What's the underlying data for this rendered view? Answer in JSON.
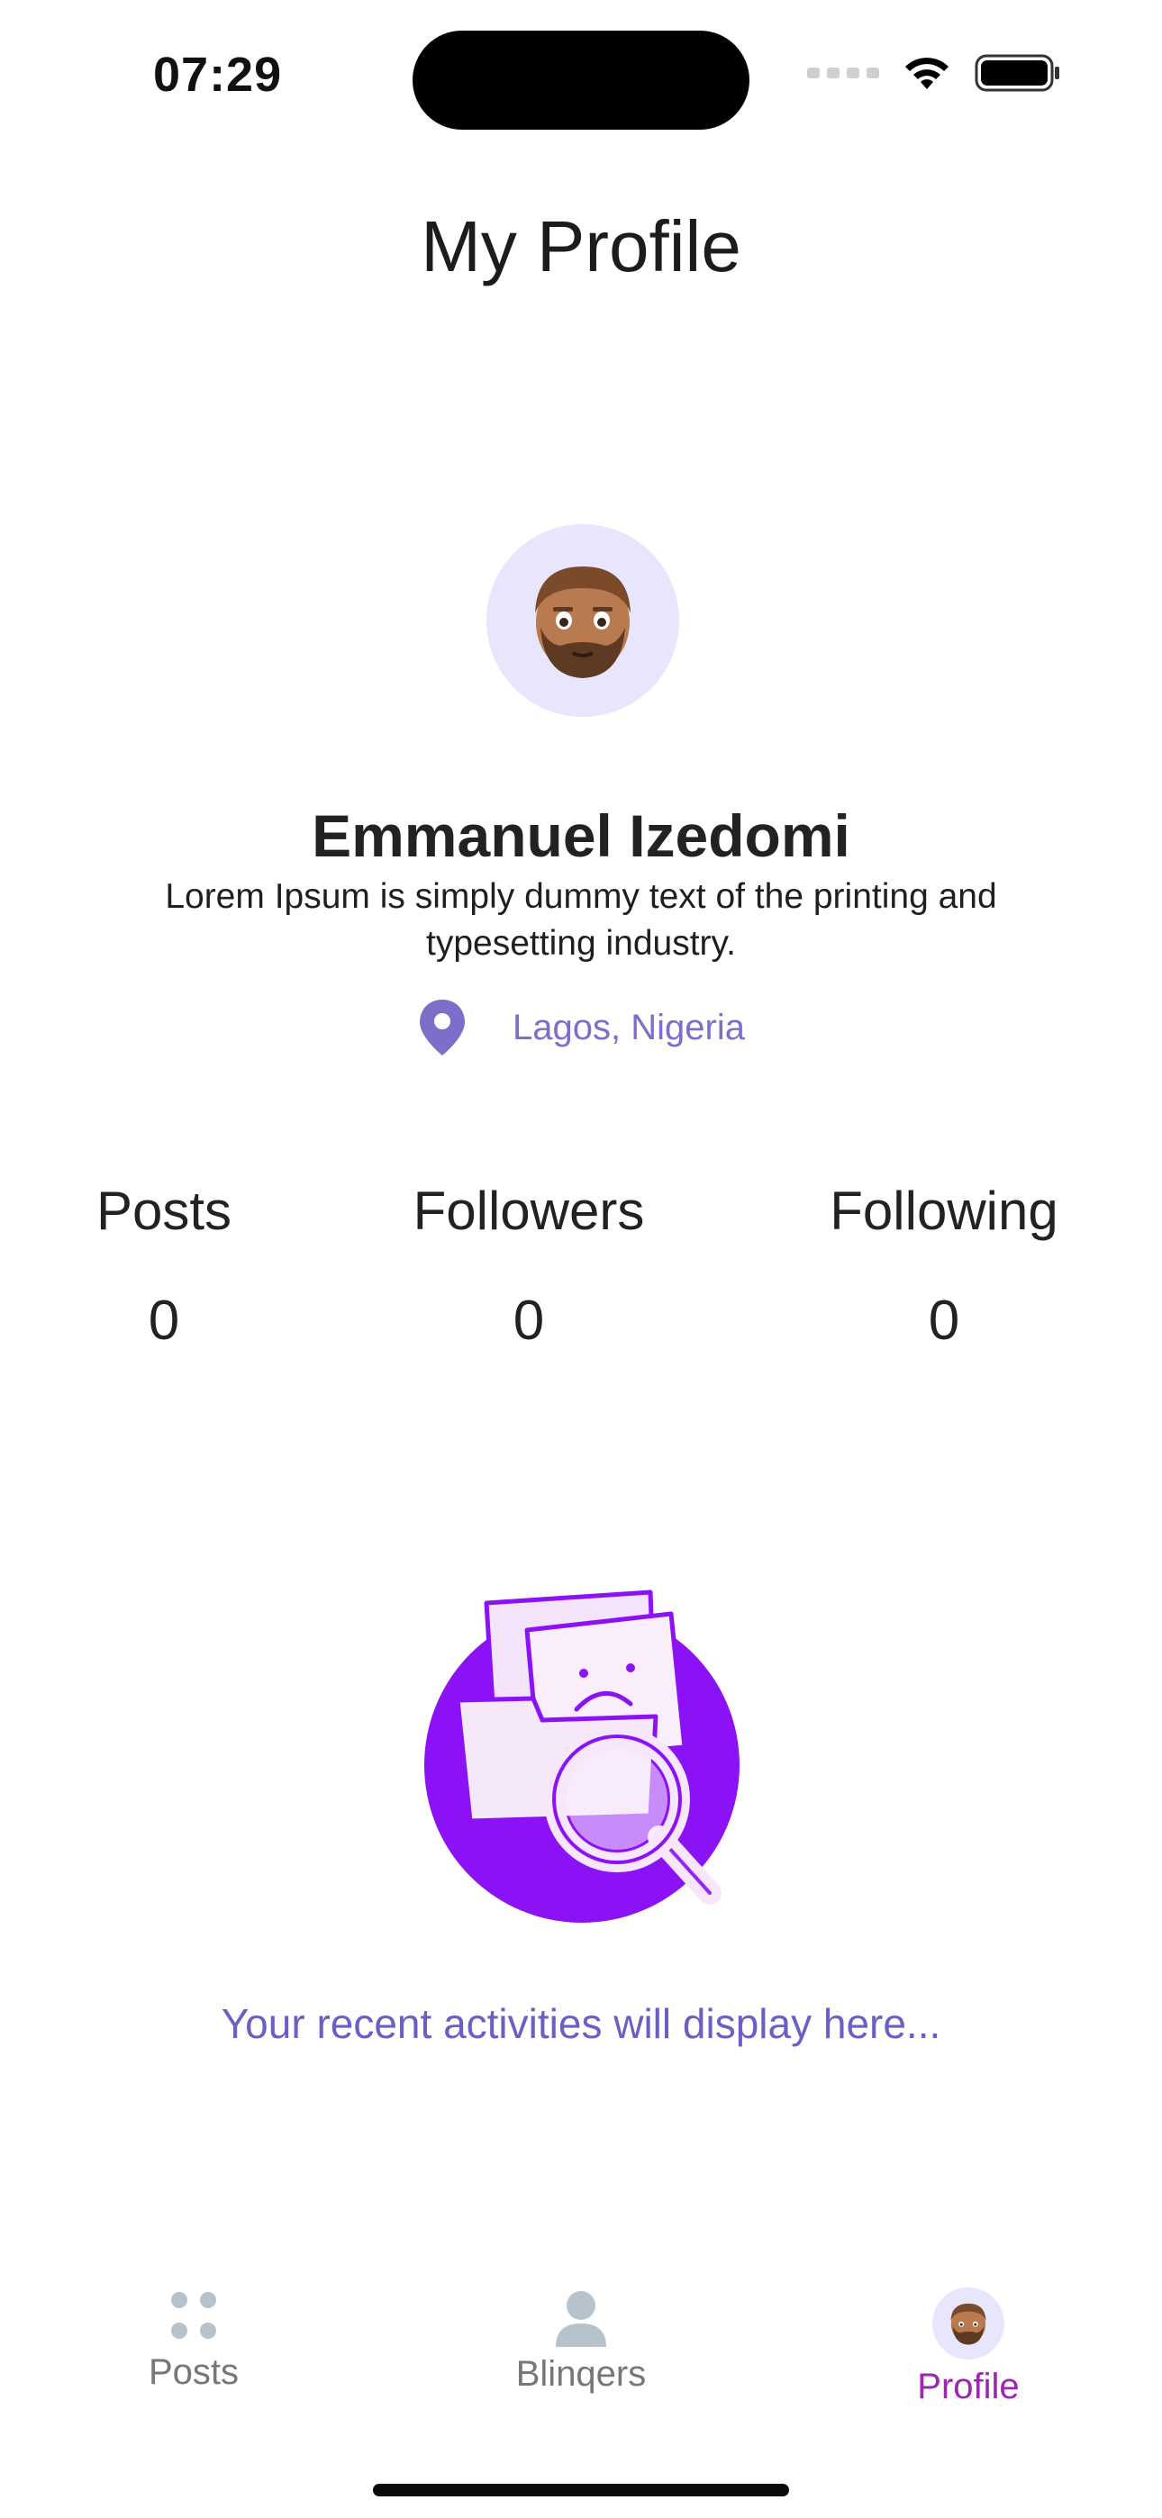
{
  "status_bar": {
    "time": "07:29"
  },
  "header": {
    "title": "My Profile"
  },
  "profile": {
    "name": "Emmanuel Izedomi",
    "bio": "Lorem Ipsum is simply dummy text of the printing and typesetting industry.",
    "location": "Lagos, Nigeria",
    "avatar_icon": "bearded-man-avatar"
  },
  "stats": [
    {
      "label": "Posts",
      "value": "0"
    },
    {
      "label": "Followers",
      "value": "0"
    },
    {
      "label": "Following",
      "value": "0"
    }
  ],
  "empty_state": {
    "message": "Your recent activities will display here...",
    "illustration": "sad-folder-search-icon"
  },
  "tabs": [
    {
      "label": "Posts",
      "icon": "grid-dots-icon",
      "active": false
    },
    {
      "label": "Blinqers",
      "icon": "person-icon",
      "active": false
    },
    {
      "label": "Profile",
      "icon": "avatar-icon",
      "active": true
    }
  ],
  "colors": {
    "accent": "#8a12f5",
    "accent_text": "#6a5fc4",
    "active_tab": "#9b27b0",
    "avatar_bg": "#e8e6fd"
  }
}
